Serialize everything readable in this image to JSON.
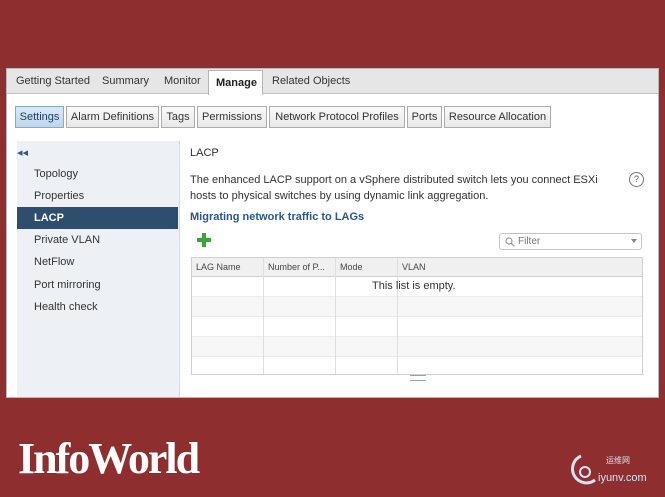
{
  "main_tabs": [
    {
      "label": "Getting Started"
    },
    {
      "label": "Summary"
    },
    {
      "label": "Monitor"
    },
    {
      "label": "Manage"
    },
    {
      "label": "Related Objects"
    }
  ],
  "sub_tabs": [
    {
      "label": "Settings"
    },
    {
      "label": "Alarm Definitions"
    },
    {
      "label": "Tags"
    },
    {
      "label": "Permissions"
    },
    {
      "label": "Network Protocol Profiles"
    },
    {
      "label": "Ports"
    },
    {
      "label": "Resource Allocation"
    }
  ],
  "sidebar": {
    "collapse_glyph": "◂◂",
    "items": [
      {
        "label": "Topology"
      },
      {
        "label": "Properties"
      },
      {
        "label": "LACP"
      },
      {
        "label": "Private VLAN"
      },
      {
        "label": "NetFlow"
      },
      {
        "label": "Port mirroring"
      },
      {
        "label": "Health check"
      }
    ]
  },
  "content": {
    "title": "LACP",
    "description": "The enhanced LACP support on a vSphere distributed switch lets you connect ESXi hosts to physical switches by using dynamic link aggregation.",
    "help_glyph": "?",
    "link": "Migrating network traffic to LAGs",
    "filter_placeholder": "Filter",
    "table": {
      "columns": [
        "LAG Name",
        "Number of P...",
        "Mode",
        "VLAN"
      ],
      "empty_message": "This list is empty."
    }
  },
  "branding": {
    "logo": "InfoWorld",
    "watermark_text": "iyunv.com",
    "watermark_cn": "运维网"
  },
  "colors": {
    "frame": "#8e2e2f",
    "sidebar_active": "#2f4d6f",
    "link": "#27578d",
    "add_icon": "#3aa63a"
  }
}
